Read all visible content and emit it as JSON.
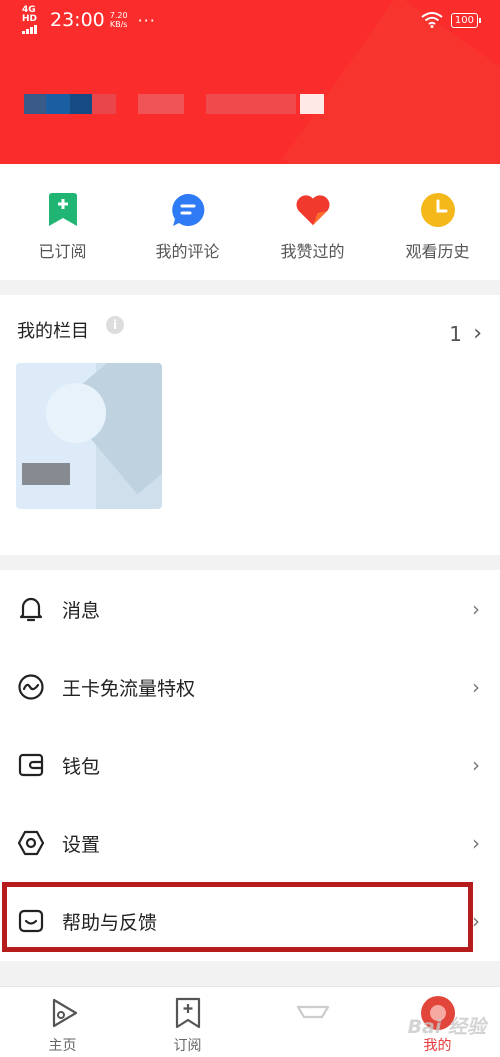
{
  "status_bar": {
    "network": "4G HD",
    "time": "23:00",
    "speed_value": "7.20",
    "speed_unit": "KB/s",
    "more": "···",
    "battery": "100"
  },
  "quick_actions": [
    {
      "label": "已订阅",
      "icon": "bookmark-plus-icon",
      "color": "#21b573"
    },
    {
      "label": "我的评论",
      "icon": "comment-bubble-icon",
      "color": "#2f7bf5"
    },
    {
      "label": "我赞过的",
      "icon": "heart-icon",
      "color": "#f03a2e"
    },
    {
      "label": "观看历史",
      "icon": "clock-icon",
      "color": "#f5b81b"
    }
  ],
  "my_columns": {
    "title": "我的栏目",
    "count": "1",
    "chevron": "›"
  },
  "menu": [
    {
      "label": "消息",
      "icon": "bell-icon",
      "chevron": "›"
    },
    {
      "label": "王卡免流量特权",
      "icon": "wave-circle-icon",
      "chevron": "›"
    },
    {
      "label": "钱包",
      "icon": "wallet-icon",
      "chevron": "›"
    },
    {
      "label": "设置",
      "icon": "gear-hexagon-icon",
      "chevron": "›"
    },
    {
      "label": "帮助与反馈",
      "icon": "feedback-icon",
      "chevron": "›"
    }
  ],
  "bottom_nav": [
    {
      "label": "主页",
      "icon": "play-home-icon",
      "active": false
    },
    {
      "label": "订阅",
      "icon": "bookmark-plus-icon",
      "active": false
    },
    {
      "label": "",
      "icon": "center-icon",
      "active": false
    },
    {
      "label": "我的",
      "icon": "avatar-icon",
      "active": true
    }
  ],
  "colors": {
    "header_red": "#fb2c2c",
    "highlight_border": "#b71c1c",
    "active_tab": "#e83a3a"
  },
  "watermark": "Bai 经验"
}
